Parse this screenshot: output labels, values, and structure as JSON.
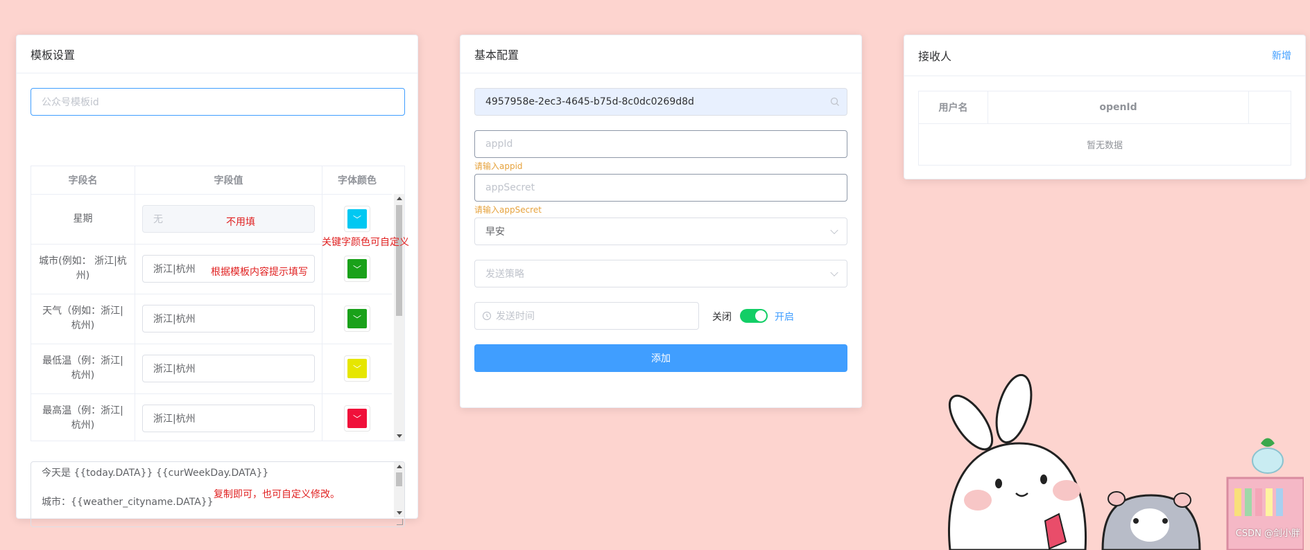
{
  "template_card": {
    "title": "模板设置",
    "template_id_placeholder": "公众号模板id",
    "table": {
      "headers": [
        "字段名",
        "字段值",
        "字体颜色"
      ],
      "rows": [
        {
          "name": "星期",
          "value": "",
          "placeholder": "无",
          "color": "#00c8f2",
          "disabled": true
        },
        {
          "name": "城市(例如： 浙江|杭州)",
          "value": "浙江|杭州",
          "color": "#1aa11a"
        },
        {
          "name": "天气（例如：浙江|杭州)",
          "value": "浙江|杭州",
          "color": "#1aa11a"
        },
        {
          "name": "最低温（例：浙江|杭州)",
          "value": "浙江|杭州",
          "color": "#e6e600"
        },
        {
          "name": "最高温（例：浙江|杭州)",
          "value": "浙江|杭州",
          "color": "#f0103a"
        }
      ]
    },
    "textarea_lines": [
      "今天是  {{today.DATA}}  {{curWeekDay.DATA}}",
      "城市：{{weather_cityname.DATA}}"
    ],
    "annotations": {
      "no_fill": "不用填",
      "custom_color": "关键字颜色可自定义",
      "fill_hint": "根据模板内容提示填写",
      "copy_hint": "复制即可，也可自定义修改。"
    }
  },
  "config_card": {
    "title": "基本配置",
    "key_value": "4957958e-2ec3-4645-b75d-8c0dc0269d8d",
    "appid_placeholder": "appId",
    "appid_error": "请输入appid",
    "appsecret_placeholder": "appSecret",
    "appsecret_error": "请输入appSecret",
    "greeting_value": "早安",
    "strategy_placeholder": "发送策略",
    "time_placeholder": "发送时间",
    "switch_off_label": "关闭",
    "switch_on_label": "开启",
    "add_button": "添加",
    "accent": "#409eff",
    "switch_color": "#13ce66"
  },
  "receiver_card": {
    "title": "接收人",
    "add_link": "新增",
    "headers": [
      "用户名",
      "openId",
      ""
    ],
    "empty_text": "暂无数据"
  },
  "watermark": "CSDN @剑小胖"
}
